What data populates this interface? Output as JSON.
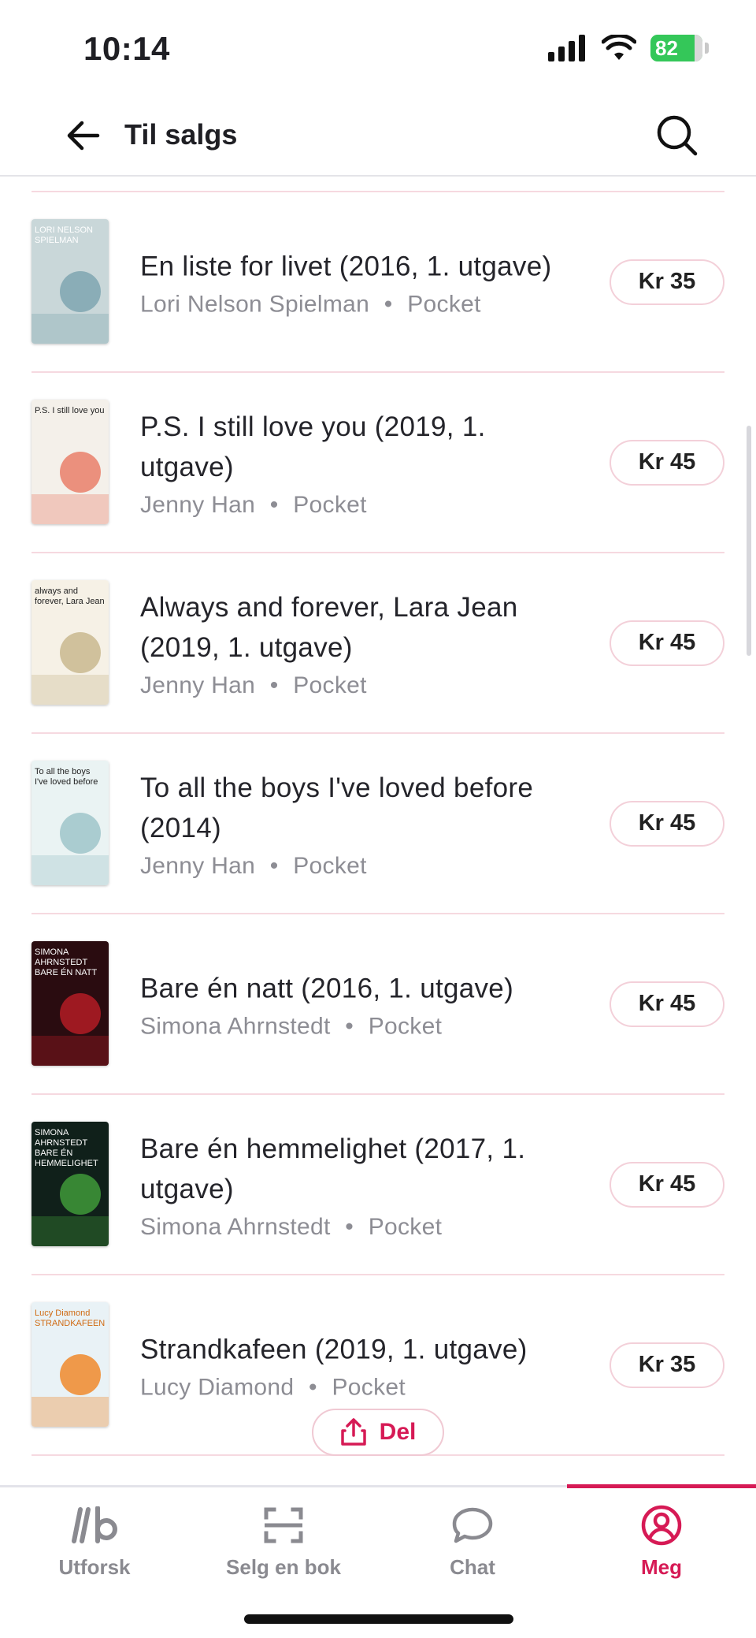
{
  "status_bar": {
    "time": "10:14",
    "battery": "82"
  },
  "header": {
    "title": "Til salgs"
  },
  "books": [
    {
      "title": "En liste for livet (2016, 1. utgave)",
      "author": "Lori Nelson Spielman",
      "format": "Pocket",
      "price": "Kr 35",
      "cover": {
        "bg": "#c9d7d9",
        "accent": "#7fa6b0",
        "text": "LORI NELSON SPIELMAN",
        "text_color": "#ffffff"
      }
    },
    {
      "title": "P.S. I still love you (2019, 1. utgave)",
      "author": "Jenny Han",
      "format": "Pocket",
      "price": "Kr 45",
      "cover": {
        "bg": "#f4f0ea",
        "accent": "#e97f6a",
        "text": "P.S. I still love you",
        "text_color": "#222222"
      }
    },
    {
      "title": "Always and forever, Lara Jean (2019, 1. utgave)",
      "author": "Jenny Han",
      "format": "Pocket",
      "price": "Kr 45",
      "cover": {
        "bg": "#f6f1e6",
        "accent": "#c9b88e",
        "text": "always and forever, Lara Jean",
        "text_color": "#222222"
      }
    },
    {
      "title": "To all the boys I've loved before (2014)",
      "author": "Jenny Han",
      "format": "Pocket",
      "price": "Kr 45",
      "cover": {
        "bg": "#eaf3f3",
        "accent": "#9fc4c9",
        "text": "To all the boys I've loved before",
        "text_color": "#222222"
      }
    },
    {
      "title": "Bare én natt (2016, 1. utgave)",
      "author": "Simona Ahrnstedt",
      "format": "Pocket",
      "price": "Kr 45",
      "cover": {
        "bg": "#2a0c10",
        "accent": "#b31c25",
        "text": "SIMONA AHRNSTEDT BARE ÉN NATT",
        "text_color": "#ffffff"
      }
    },
    {
      "title": "Bare én hemmelighet (2017, 1. utgave)",
      "author": "Simona Ahrnstedt",
      "format": "Pocket",
      "price": "Kr 45",
      "cover": {
        "bg": "#10201a",
        "accent": "#3f9a3a",
        "text": "SIMONA AHRNSTEDT BARE ÉN HEMMELIGHET",
        "text_color": "#ffffff"
      }
    },
    {
      "title": "Strandkafeen (2019, 1. utgave)",
      "author": "Lucy Diamond",
      "format": "Pocket",
      "price": "Kr 35",
      "cover": {
        "bg": "#e9f2f6",
        "accent": "#f08a2c",
        "text": "Lucy Diamond STRANDKAFEEN",
        "text_color": "#d06a12"
      }
    }
  ],
  "separator": "•",
  "share_button": {
    "label": "Del"
  },
  "tabs": [
    {
      "label": "Utforsk",
      "icon": "logo-icon",
      "active": false
    },
    {
      "label": "Selg en bok",
      "icon": "scan-icon",
      "active": false
    },
    {
      "label": "Chat",
      "icon": "chat-bubble-icon",
      "active": false
    },
    {
      "label": "Meg",
      "icon": "profile-icon",
      "active": true
    }
  ],
  "colors": {
    "accent": "#d61a55",
    "divider": "#f6d9e0",
    "muted": "#8d8d94"
  }
}
